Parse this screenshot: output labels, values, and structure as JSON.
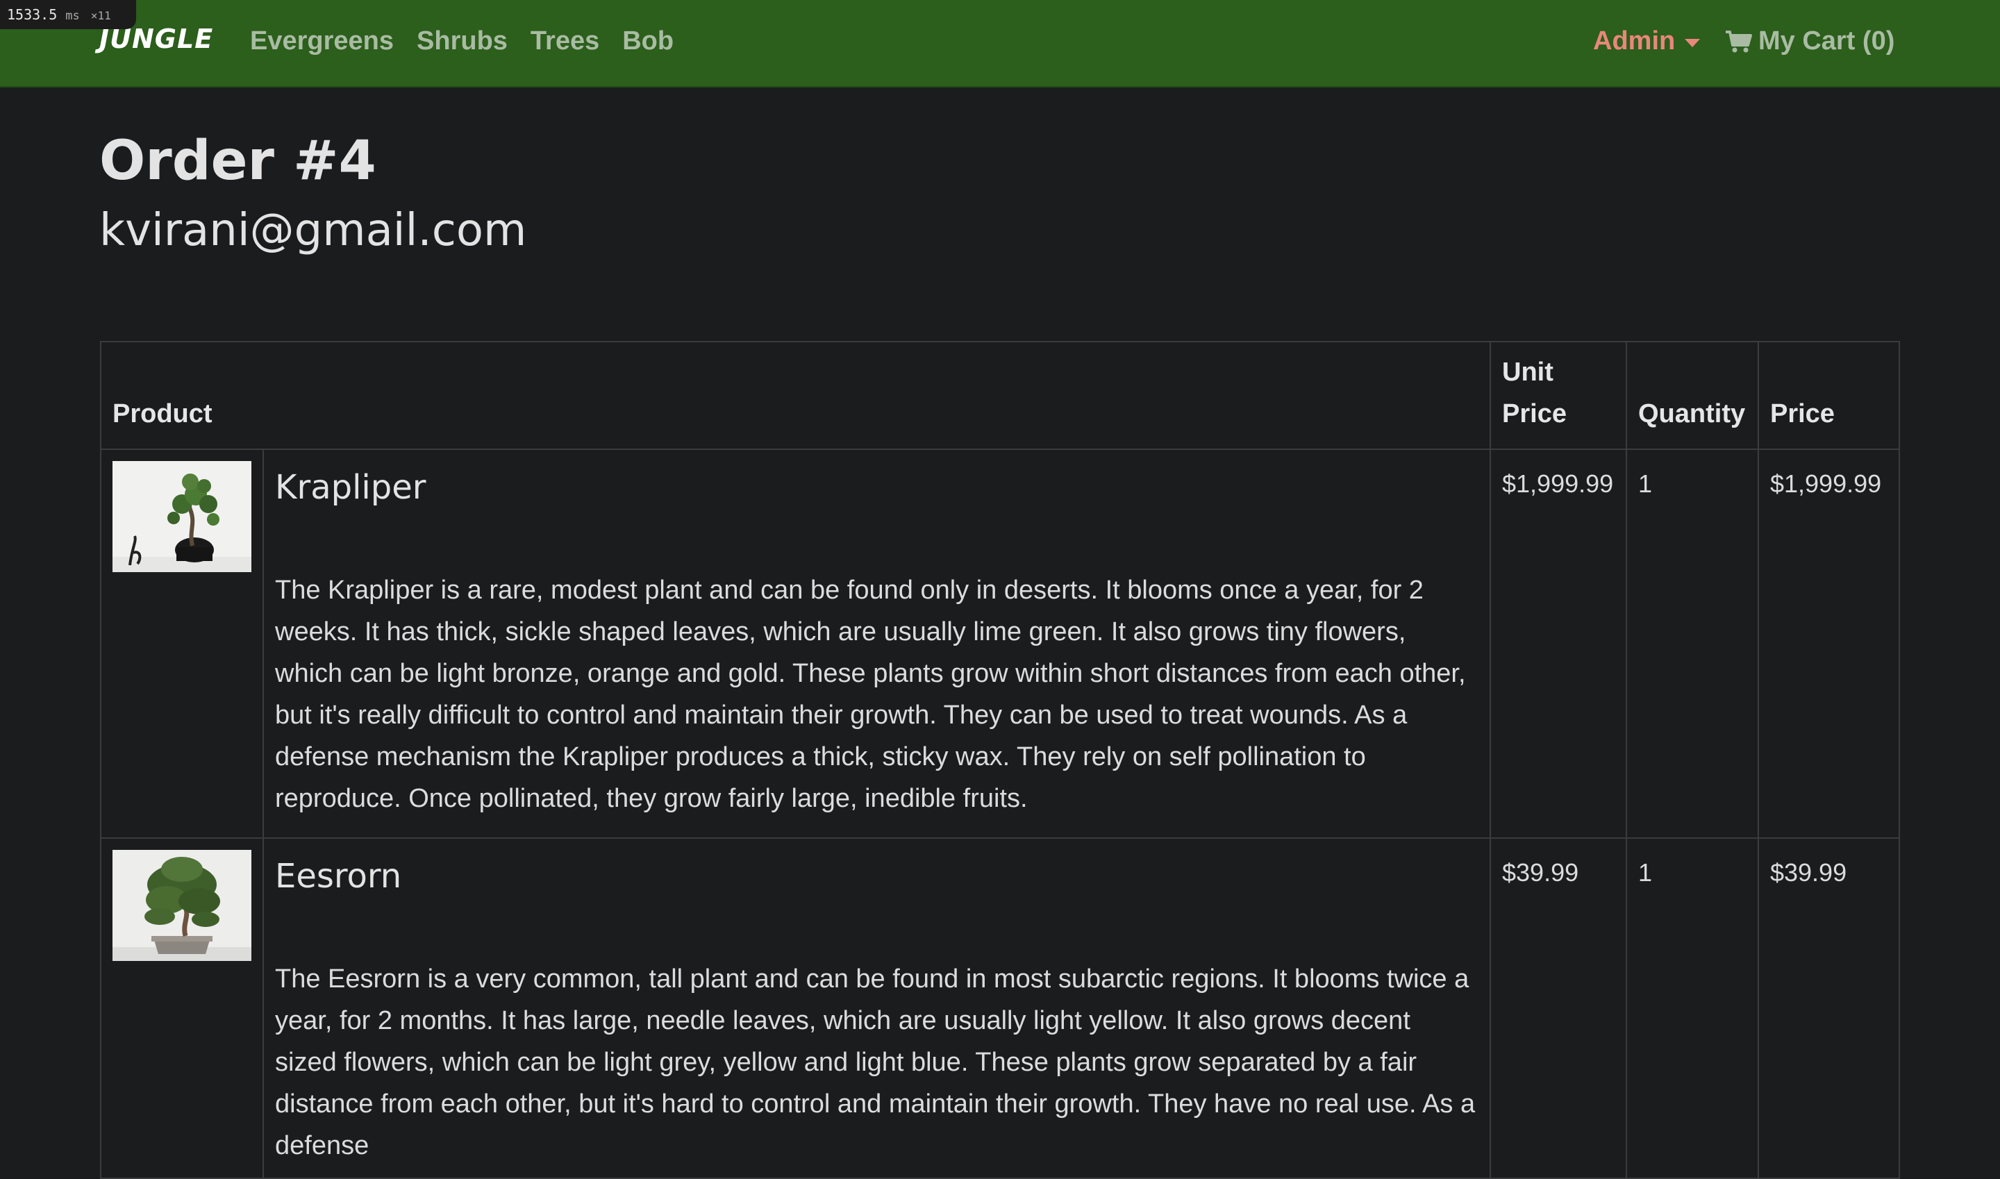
{
  "debug": {
    "timing": "1533.5",
    "unit": "ms",
    "count": "×11"
  },
  "nav": {
    "brand": "JUNGLE",
    "links": [
      "Evergreens",
      "Shrubs",
      "Trees",
      "Bob"
    ],
    "admin_label": "Admin",
    "cart_label": "My Cart (0)"
  },
  "order": {
    "title": "Order #4",
    "email": "kvirani@gmail.com"
  },
  "table": {
    "headers": {
      "product": "Product",
      "unit_price_line1": "Unit",
      "unit_price_line2": "Price",
      "quantity": "Quantity",
      "price": "Price"
    },
    "rows": [
      {
        "name": "Krapliper",
        "description": "The Krapliper is a rare, modest plant and can be found only in deserts. It blooms once a year, for 2 weeks. It has thick, sickle shaped leaves, which are usually lime green. It also grows tiny flowers, which can be light bronze, orange and gold. These plants grow within short distances from each other, but it's really difficult to control and maintain their growth. They can be used to treat wounds. As a defense mechanism the Krapliper produces a thick, sticky wax. They rely on self pollination to reproduce. Once pollinated, they grow fairly large, inedible fruits.",
        "unit_price": "$1,999.99",
        "quantity": "1",
        "price": "$1,999.99"
      },
      {
        "name": "Eesrorn",
        "description": "The Eesrorn is a very common, tall plant and can be found in most subarctic regions. It blooms twice a year, for 2 months. It has large, needle leaves, which are usually light yellow. It also grows decent sized flowers, which can be light grey, yellow and light blue. These plants grow separated by a fair distance from each other, but it's hard to control and maintain their growth. They have no real use. As a defense",
        "unit_price": "$39.99",
        "quantity": "1",
        "price": "$39.99"
      }
    ]
  },
  "colors": {
    "navbar": "#2c5e1c",
    "background": "#1b1c1e",
    "admin_accent": "#e9877c",
    "nav_link": "#a9bca3"
  },
  "icons": {
    "cart": "shopping-cart-icon",
    "dropdown": "caret-down-icon"
  }
}
